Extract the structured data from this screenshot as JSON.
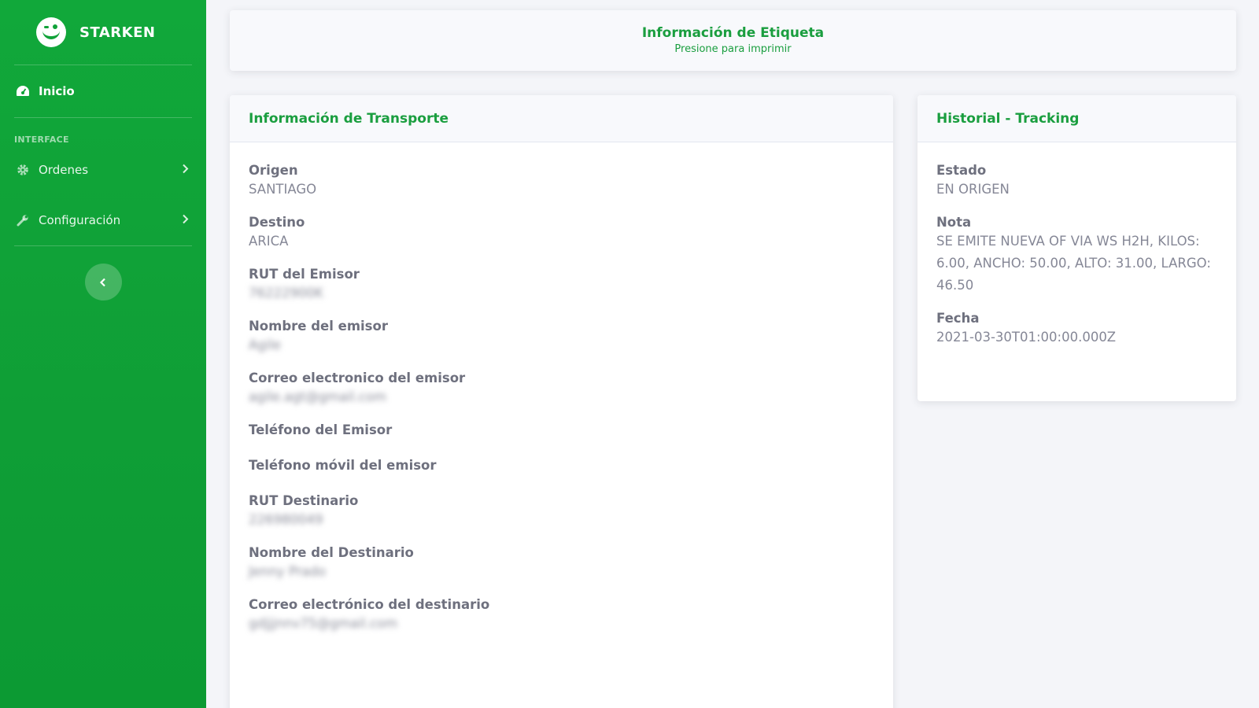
{
  "sidebar": {
    "brand": "STARKEN",
    "nav_home": "Inicio",
    "section_heading": "INTERFACE",
    "items": [
      {
        "label": "Ordenes",
        "icon": "gear-icon"
      },
      {
        "label": "Configuración",
        "icon": "wrench-icon"
      }
    ],
    "toggle_icon": "chevron-left-icon"
  },
  "label_card": {
    "title": "Información de Etiqueta",
    "subtitle": "Presione para imprimir"
  },
  "transport": {
    "title": "Información de Transporte",
    "fields": [
      {
        "label": "Origen",
        "value": "SANTIAGO"
      },
      {
        "label": "Destino",
        "value": "ARICA"
      },
      {
        "label": "RUT del Emisor",
        "value": "76222900K"
      },
      {
        "label": "Nombre del emisor",
        "value": "Agile"
      },
      {
        "label": "Correo electronico del emisor",
        "value": "agile.agt@gmail.com"
      },
      {
        "label": "Teléfono del Emisor",
        "value": ""
      },
      {
        "label": "Teléfono móvil del emisor",
        "value": ""
      },
      {
        "label": "RUT Destinario",
        "value": "226980049"
      },
      {
        "label": "Nombre del Destinario",
        "value": "Jenny Prado"
      },
      {
        "label": "Correo electrónico del destinario",
        "value": "gdjjjnnv75@gmail.com"
      }
    ]
  },
  "history": {
    "title": "Historial - Tracking",
    "fields": [
      {
        "label": "Estado",
        "value": "EN ORIGEN"
      },
      {
        "label": "Nota",
        "value": "SE EMITE NUEVA OF VIA WS H2H, KILOS: 6.00, ANCHO: 50.00, ALTO: 31.00, LARGO: 46.50"
      },
      {
        "label": "Fecha",
        "value": "2021-03-30T01:00:00.000Z"
      }
    ]
  },
  "colors": {
    "sidebar": "#0f9e36",
    "accent": "#1a9e3f",
    "background": "#f4f5f9"
  }
}
